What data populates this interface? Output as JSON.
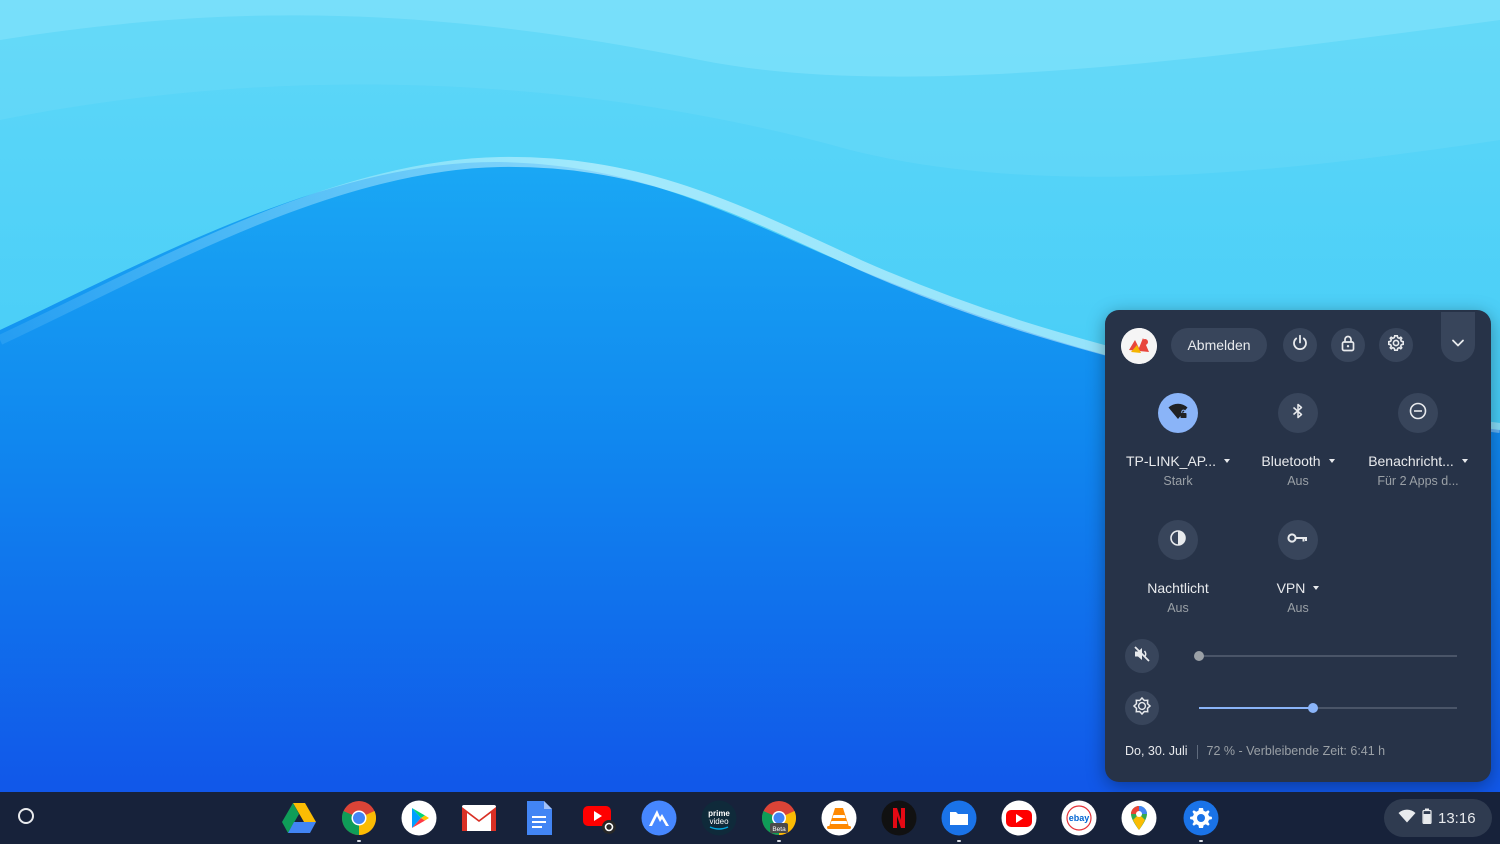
{
  "quick_settings": {
    "sign_out_label": "Abmelden",
    "icons": {
      "power": "power-icon",
      "lock": "lock-icon",
      "settings": "gear-icon",
      "collapse": "chevron-down-icon"
    },
    "tiles": [
      {
        "label": "TP-LINK_AP...",
        "sub": "Stark",
        "icon": "wifi-icon",
        "active": true,
        "has_menu": true
      },
      {
        "label": "Bluetooth",
        "sub": "Aus",
        "icon": "bluetooth-icon",
        "active": false,
        "has_menu": true
      },
      {
        "label": "Benachricht...",
        "sub": "Für 2 Apps d...",
        "icon": "do-not-disturb-icon",
        "active": false,
        "has_menu": true
      },
      {
        "label": "Nachtlicht",
        "sub": "Aus",
        "icon": "night-light-icon",
        "active": false,
        "has_menu": false
      },
      {
        "label": "VPN",
        "sub": "Aus",
        "icon": "vpn-key-icon",
        "active": false,
        "has_menu": true
      }
    ],
    "volume": {
      "icon": "volume-muted-icon",
      "level": 0
    },
    "brightness": {
      "icon": "brightness-icon",
      "level": 0.44
    },
    "date": "Do, 30. Juli",
    "battery_text": "72 % - Verbleibende Zeit: 6:41 h"
  },
  "shelf": {
    "launcher_icon": "launcher-circle-icon",
    "apps": [
      {
        "name": "google-drive-icon",
        "running": false
      },
      {
        "name": "chrome-icon",
        "running": true
      },
      {
        "name": "play-store-icon",
        "running": false
      },
      {
        "name": "gmail-icon",
        "running": false
      },
      {
        "name": "google-docs-icon",
        "running": false
      },
      {
        "name": "youtube-studio-icon",
        "running": false
      },
      {
        "name": "nordvpn-icon",
        "running": false
      },
      {
        "name": "prime-video-icon",
        "running": false
      },
      {
        "name": "chrome-beta-icon",
        "running": true
      },
      {
        "name": "vlc-icon",
        "running": false
      },
      {
        "name": "netflix-icon",
        "running": false
      },
      {
        "name": "files-icon",
        "running": true
      },
      {
        "name": "youtube-icon",
        "running": false
      },
      {
        "name": "ebay-icon",
        "running": false
      },
      {
        "name": "google-maps-icon",
        "running": false
      },
      {
        "name": "settings-app-icon",
        "running": true
      }
    ],
    "prime_label": "prime video",
    "beta_label": "Beta",
    "ebay_label": "ebay",
    "time": "13:16"
  },
  "colors": {
    "accent": "#8ab4f8",
    "panel": "#273348",
    "shelf": "#17223a"
  }
}
